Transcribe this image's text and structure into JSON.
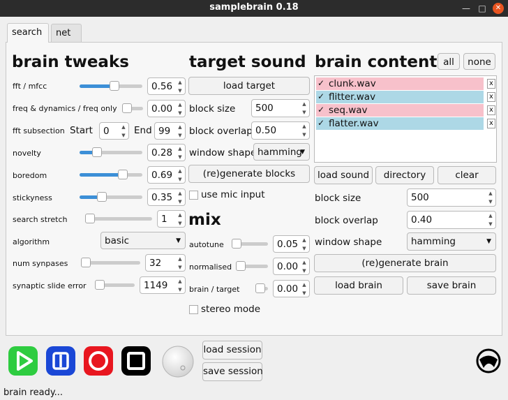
{
  "window": {
    "title": "samplebrain 0.18",
    "min": "—",
    "max": "□",
    "close": "✕"
  },
  "tabs": [
    "search",
    "net"
  ],
  "left": {
    "title": "brain tweaks",
    "fft_mfcc": {
      "label": "fft / mfcc",
      "value": "0.56",
      "level": 0.56
    },
    "freq_dyn": {
      "label": "freq & dynamics / freq only",
      "value": "0.00",
      "level": 0.0
    },
    "fft_sub": {
      "label": "fft subsection",
      "start_label": "Start",
      "start_value": "0",
      "end_label": "End",
      "end_value": "99"
    },
    "novelty": {
      "label": "novelty",
      "value": "0.28",
      "level": 0.28
    },
    "boredom": {
      "label": "boredom",
      "value": "0.69",
      "level": 0.69
    },
    "stickyness": {
      "label": "stickyness",
      "value": "0.35",
      "level": 0.35
    },
    "search_stretch": {
      "label": "search stretch",
      "value": "1",
      "level": 0.0
    },
    "algorithm": {
      "label": "algorithm",
      "value": "basic"
    },
    "num_synapses": {
      "label": "num synpases",
      "value": "32",
      "level": 0.03
    },
    "synaptic_slide": {
      "label": "synaptic slide error",
      "value": "1149",
      "level": 0.1
    }
  },
  "mid": {
    "title": "target sound",
    "load_target": "load target",
    "block_size": {
      "label": "block size",
      "value": "500"
    },
    "block_overlap": {
      "label": "block overlap",
      "value": "0.50"
    },
    "window_shape": {
      "label": "window shape",
      "value": "hamming"
    },
    "regen_blocks": "(re)generate blocks",
    "use_mic": "use mic input",
    "mix_title": "mix",
    "autotune": {
      "label": "autotune",
      "value": "0.05",
      "level": 0.05
    },
    "normalised": {
      "label": "normalised",
      "value": "0.00",
      "level": 0.0
    },
    "brain_target": {
      "label": "brain / target",
      "value": "0.00",
      "level": 0.0
    },
    "stereo": "stereo mode"
  },
  "right": {
    "title": "brain contents",
    "all": "all",
    "none": "none",
    "files": [
      {
        "name": "clunk.wav",
        "check": "✓",
        "color": "#f7c1cb",
        "x": "x"
      },
      {
        "name": "flitter.wav",
        "check": "✓",
        "color": "#add8e6",
        "x": "x"
      },
      {
        "name": "seq.wav",
        "check": "✓",
        "color": "#f7c1cb",
        "x": "x"
      },
      {
        "name": "flatter.wav",
        "check": "✓",
        "color": "#add8e6",
        "x": "x"
      }
    ],
    "load_sound": "load sound",
    "directory": "directory",
    "clear": "clear",
    "block_size": {
      "label": "block size",
      "value": "500"
    },
    "block_overlap": {
      "label": "block overlap",
      "value": "0.40"
    },
    "window_shape": {
      "label": "window shape",
      "value": "hamming"
    },
    "regen_brain": "(re)generate brain",
    "load_brain": "load brain",
    "save_brain": "save brain"
  },
  "bottom": {
    "load_session": "load session",
    "save_session": "save session",
    "status": "brain ready..."
  },
  "icons": {
    "play": "play-icon",
    "pause": "pause-icon",
    "record": "record-icon",
    "stop": "stop-icon",
    "volume": "volume-knob-icon",
    "logo": "aphex-logo-icon"
  },
  "colors": {
    "play": "#2ecc40",
    "pause": "#1a47d6",
    "record": "#e8161f",
    "stop": "#000000",
    "accent": "#3c8fd7"
  }
}
